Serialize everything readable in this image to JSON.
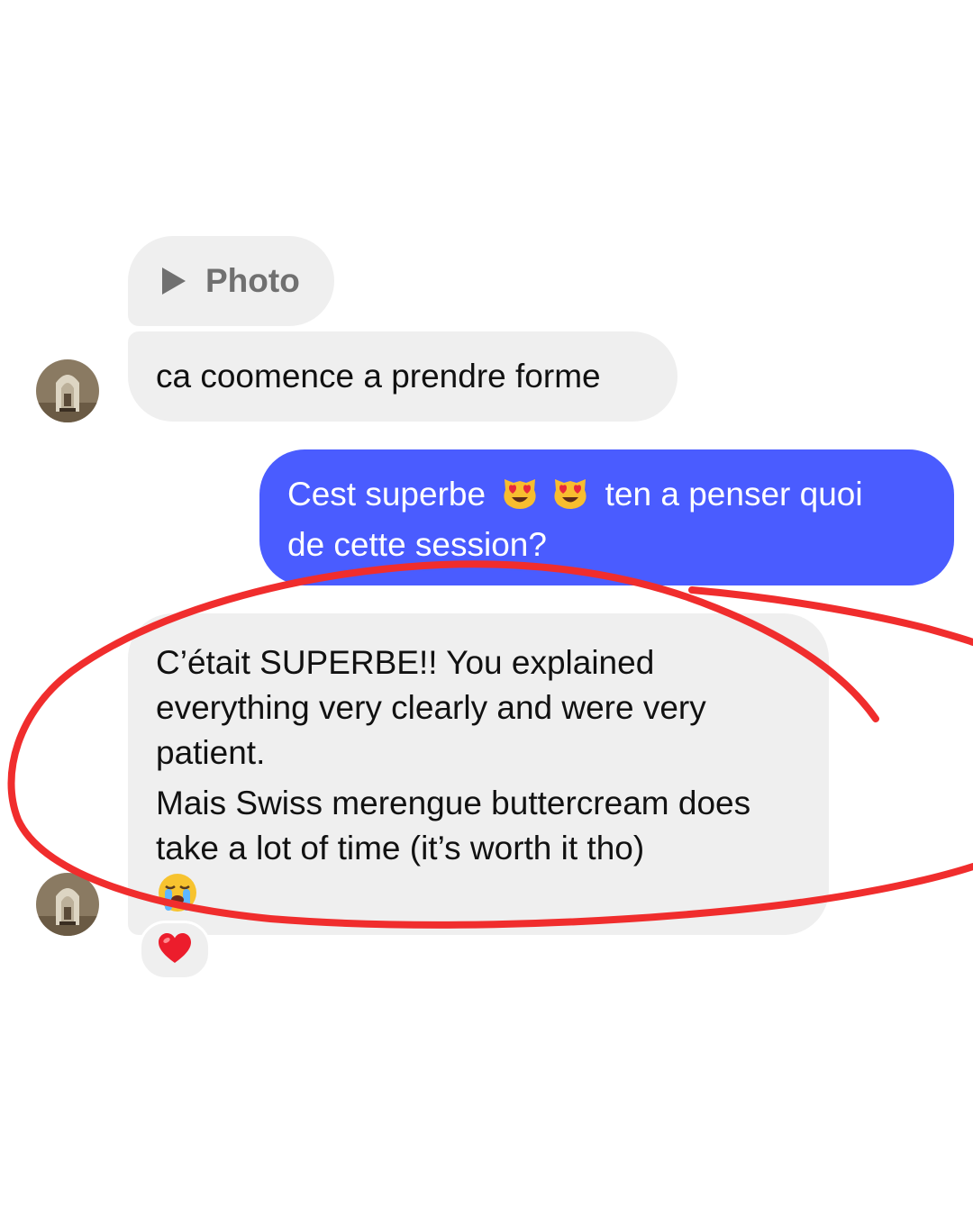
{
  "conversation": {
    "photo_attachment": {
      "label": "Photo",
      "icon": "play-icon"
    },
    "messages": [
      {
        "direction": "incoming",
        "text": "ca coomence a prendre forme"
      },
      {
        "direction": "outgoing",
        "part_1": "Cest superbe",
        "emoji_icons": [
          "heart-eyes-cat-icon",
          "heart-eyes-cat-icon"
        ],
        "part_2": "ten a penser quoi",
        "part_3": "de cette session?"
      },
      {
        "direction": "incoming",
        "paragraph_1": "C’était SUPERBE!! You explained everything very clearly and were very patient.",
        "paragraph_2": "Mais Swiss merengue buttercream does take a lot of time (it’s worth it tho)",
        "trailing_emoji_icon": "loudly-crying-face-icon",
        "reaction_icon": "red-heart-icon"
      }
    ]
  },
  "colors": {
    "incoming_bubble": "#efefef",
    "outgoing_bubble": "#4a5cff",
    "annotation_circle": "#f02d2d"
  }
}
